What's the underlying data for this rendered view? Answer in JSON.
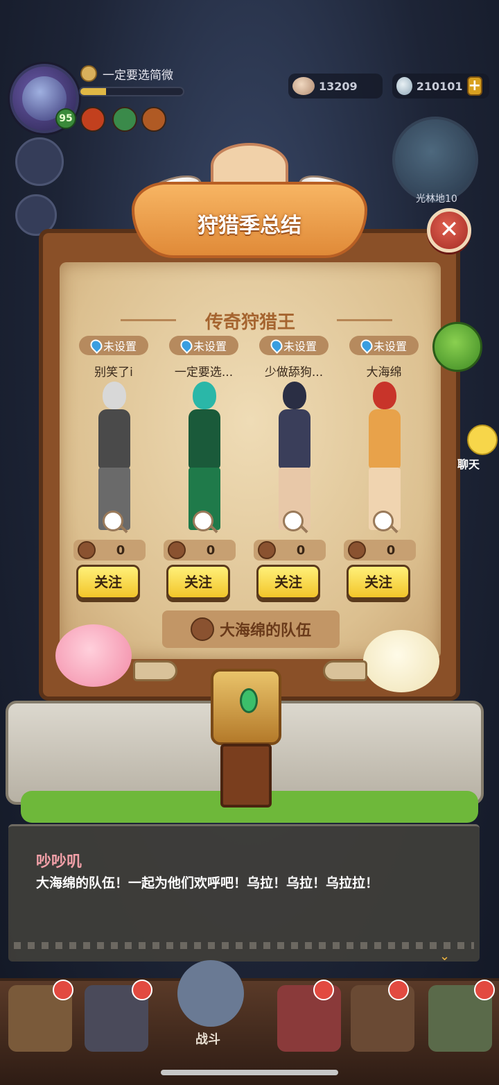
{
  "hud": {
    "player_name": "一定要选简微",
    "level": "95",
    "xp_progress": 0.25,
    "coins": "13209",
    "gems": "210101",
    "plus_label": "+",
    "map_label": "光林地10"
  },
  "dialog_box": {
    "title": "狩猎季总结",
    "close_label": "✕",
    "section_title": "传奇狩猎王",
    "players": [
      {
        "location": "未设置",
        "nickname": "别笑了i",
        "likes": "0",
        "follow_label": "关注"
      },
      {
        "location": "未设置",
        "nickname": "一定要选...",
        "likes": "0",
        "follow_label": "关注"
      },
      {
        "location": "未设置",
        "nickname": "少做舔狗...",
        "likes": "0",
        "follow_label": "关注"
      },
      {
        "location": "未设置",
        "nickname": "大海绵",
        "likes": "0",
        "follow_label": "关注"
      }
    ],
    "team_label": "大海绵的队伍"
  },
  "side": {
    "chat_label": "聊天"
  },
  "dialogue": {
    "speaker": "吵吵叽",
    "text": "大海绵的队伍！一起为他们欢呼吧！乌拉！乌拉！乌拉拉！",
    "next_symbol": "⌄"
  },
  "bottom_nav": {
    "battle_label": "战斗"
  },
  "colors": {
    "parchment": "#e6ceA0",
    "follow_button": "#f2c52a",
    "title_text": "#a5642f",
    "speaker_pink": "#f2a0a8"
  }
}
